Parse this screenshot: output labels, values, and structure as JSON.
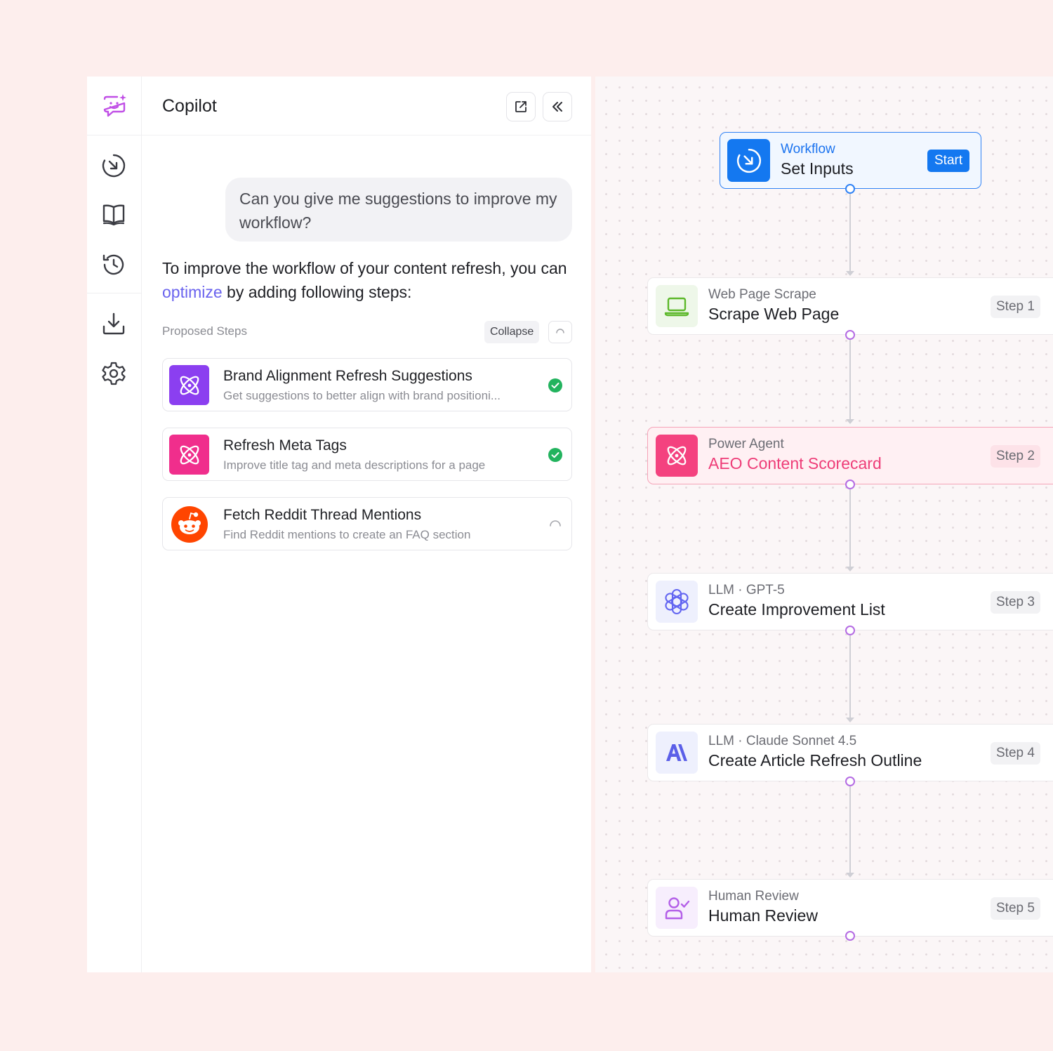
{
  "copilot": {
    "title": "Copilot",
    "user_message": "Can you give me suggestions to improve my workflow?",
    "answer_prefix": "To improve the workflow of your content refresh, you can ",
    "answer_link": "optimize",
    "answer_suffix": " by adding following steps:",
    "proposed_label": "Proposed Steps",
    "collapse_label": "Collapse",
    "steps": [
      {
        "title": "Brand Alignment Refresh Suggestions",
        "description": "Get suggestions to better align with brand positioni...",
        "status": "done",
        "icon": "atom-icon",
        "color": "#8b3ff0"
      },
      {
        "title": "Refresh Meta Tags",
        "description": "Improve title tag and meta descriptions for a page",
        "status": "done",
        "icon": "atom-icon",
        "color": "#f02e8c"
      },
      {
        "title": "Fetch Reddit Thread Mentions",
        "description": "Find Reddit mentions to create an FAQ section",
        "status": "loading",
        "icon": "reddit-icon",
        "color": "#ff4500"
      }
    ]
  },
  "rail": {
    "icons": [
      "copilot-icon",
      "workflow-run-icon",
      "book-icon",
      "history-icon",
      "download-icon",
      "settings-icon"
    ]
  },
  "workflow": {
    "start": {
      "type": "Workflow",
      "name": "Set Inputs",
      "badge": "Start"
    },
    "nodes": [
      {
        "type": "Web Page Scrape",
        "name": "Scrape Web Page",
        "badge": "Step 1",
        "icon": "laptop-icon"
      },
      {
        "type": "Power Agent",
        "name": "AEO Content Scorecard",
        "badge": "Step 2",
        "icon": "atom-icon",
        "highlighted": true
      },
      {
        "type": "LLM · GPT-5",
        "name": "Create Improvement List",
        "badge": "Step 3",
        "icon": "openai-icon"
      },
      {
        "type": "LLM · Claude Sonnet 4.5",
        "name": "Create Article Refresh Outline",
        "badge": "Step 4",
        "icon": "anthropic-icon"
      },
      {
        "type": "Human Review",
        "name": "Human Review",
        "badge": "Step 5",
        "icon": "human-review-icon"
      }
    ]
  },
  "colors": {
    "accent_blue": "#1478f0",
    "accent_pink": "#ee3d78",
    "link_purple": "#6a63ee",
    "success_green": "#22b35e"
  }
}
